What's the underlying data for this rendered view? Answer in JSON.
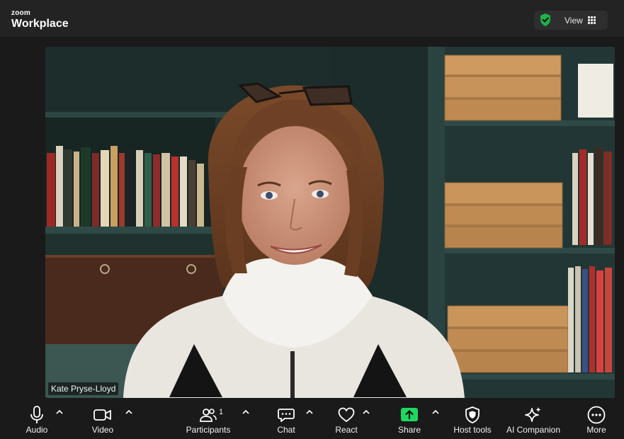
{
  "app": {
    "brand_small": "zoom",
    "brand_large": "Workplace"
  },
  "header": {
    "view_label": "View",
    "security_icon": "shield-check-icon",
    "view_icon": "grid-icon"
  },
  "video": {
    "participant_name": "Kate Pryse-Lloyd"
  },
  "toolbar": {
    "audio": "Audio",
    "video": "Video",
    "participants": "Participants",
    "participants_count": "1",
    "chat": "Chat",
    "react": "React",
    "share": "Share",
    "host_tools": "Host tools",
    "ai_companion": "AI Companion",
    "more": "More"
  },
  "colors": {
    "share_accent": "#1ed760",
    "shield_accent": "#1fb24a",
    "topbar": "#232323",
    "toolbar": "#1a1a1a"
  }
}
